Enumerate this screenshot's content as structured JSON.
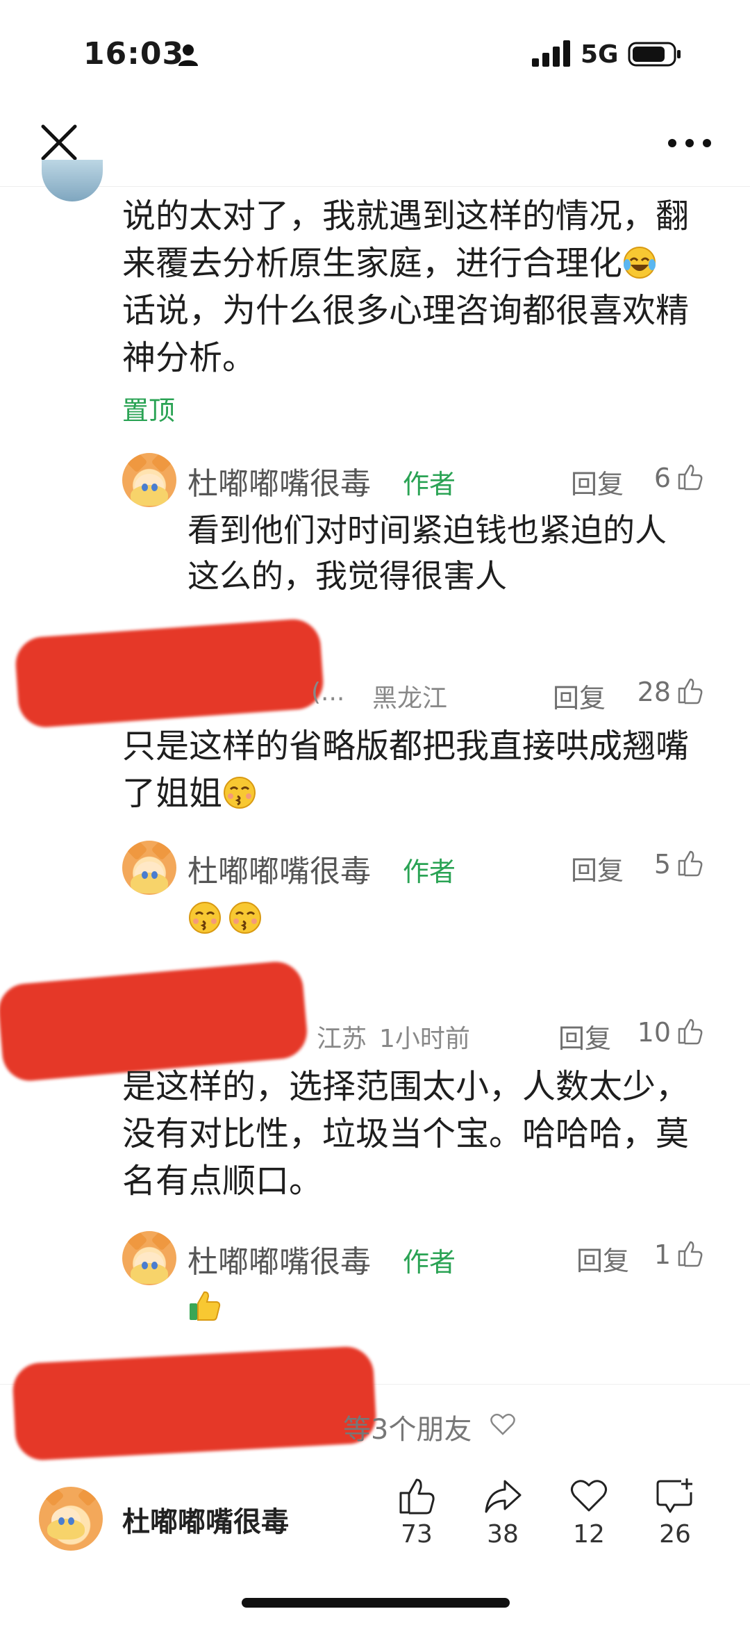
{
  "status_bar": {
    "time": "16:03",
    "network": "5G",
    "icons": [
      "person-icon",
      "signal-icon",
      "battery-icon"
    ]
  },
  "nav": {
    "close_icon": "close-icon",
    "more_icon": "more-icon"
  },
  "colors": {
    "accent_green": "#2aa354",
    "redaction": "#e53222",
    "text_primary": "#1e1e1e",
    "text_secondary": "#6f6f6f"
  },
  "thread": {
    "top_comment": {
      "lines": [
        "说的太对了，我就遇到这样的情况，翻",
        "来覆去分析原生家庭，进行合理化",
        "话说，为什么很多心理咨询都很喜欢精",
        "神分析。"
      ],
      "emoji": "laughing-tears-emoji",
      "pinned_label": "置顶",
      "reply": {
        "author": "杜嘟嘟嘴很毒",
        "author_tag": "作者",
        "reply_label": "回复",
        "likes": "6",
        "lines": [
          "看到他们对时间紧迫钱也紧迫的人",
          "这么的，我觉得很害人"
        ]
      }
    },
    "comment_2": {
      "name_fragment": "(...",
      "location": "黑龙江",
      "reply_label": "回复",
      "likes": "28",
      "lines": [
        "只是这样的省略版都把我直接哄成翘嘴",
        "了姐姐"
      ],
      "emoji": "kissing-emoji",
      "reply": {
        "author": "杜嘟嘟嘴很毒",
        "author_tag": "作者",
        "reply_label": "回复",
        "likes": "5",
        "emojis": [
          "kissing-emoji",
          "kissing-emoji"
        ]
      }
    },
    "comment_3": {
      "location": "江苏",
      "time": "1小时前",
      "reply_label": "回复",
      "likes": "10",
      "lines": [
        "是这样的，选择范围太小，人数太少，",
        "没有对比性，垃圾当个宝。哈哈哈，莫",
        "名有点顺口。"
      ],
      "reply": {
        "author": "杜嘟嘟嘴很毒",
        "author_tag": "作者",
        "reply_label": "回复",
        "likes": "1",
        "emoji": "thumbs-up-emoji"
      }
    }
  },
  "friends_bar": {
    "text": "等3个朋友",
    "icon": "heart-icon"
  },
  "bottom_bar": {
    "author": "杜嘟嘟嘴很毒",
    "actions": [
      {
        "name": "like",
        "icon": "thumbs-up-icon",
        "count": "73"
      },
      {
        "name": "share",
        "icon": "share-icon",
        "count": "38"
      },
      {
        "name": "favorite",
        "icon": "heart-icon",
        "count": "12"
      },
      {
        "name": "comment",
        "icon": "comment-icon",
        "count": "26"
      }
    ]
  }
}
